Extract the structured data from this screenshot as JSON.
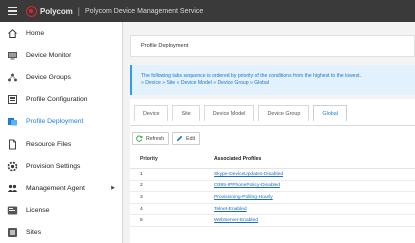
{
  "topbar": {
    "brand": "Polycom",
    "app_title": "Polycom Device Management Service"
  },
  "sidebar": {
    "items": [
      {
        "label": "Home",
        "icon": "home-icon"
      },
      {
        "label": "Device Monitor",
        "icon": "monitor-icon"
      },
      {
        "label": "Device Groups",
        "icon": "device-groups-icon"
      },
      {
        "label": "Profile Configuration",
        "icon": "profile-config-icon"
      },
      {
        "label": "Profile Deployment",
        "icon": "profile-deployment-icon",
        "active": true
      },
      {
        "label": "Resource Files",
        "icon": "file-icon"
      },
      {
        "label": "Provision Settings",
        "icon": "gear-icon"
      },
      {
        "label": "Management Agent",
        "icon": "users-icon",
        "has_submenu": true
      },
      {
        "label": "License",
        "icon": "license-icon"
      },
      {
        "label": "Sites",
        "icon": "sites-icon"
      }
    ]
  },
  "main": {
    "header": "Profile Deployment",
    "info_line1": "The following tabs sequence is ordered by priority of the conditions from the highest to the lowest.",
    "info_line2": "» Device » Site » Device Model » Device Group » Global",
    "tabs": [
      {
        "label": "Device"
      },
      {
        "label": "Site"
      },
      {
        "label": "Device Model"
      },
      {
        "label": "Device Group"
      },
      {
        "label": "Global",
        "active": true
      }
    ],
    "buttons": {
      "refresh": "Refresh",
      "edit": "Edit"
    },
    "table": {
      "columns": [
        "Priority",
        "Associated Profiles"
      ],
      "rows": [
        {
          "priority": "1",
          "profile": "Skype-DeviceUpdates-Disabled"
        },
        {
          "priority": "2",
          "profile": "O365-IPPhonePolicy-Disabled"
        },
        {
          "priority": "3",
          "profile": "Provisioning-Polling-Hourly"
        },
        {
          "priority": "4",
          "profile": "Telnet-Enabled"
        },
        {
          "priority": "5",
          "profile": "WebServer-Enabled"
        }
      ]
    }
  },
  "colors": {
    "accent": "#1a7fd4",
    "topbar": "#3a3a3a",
    "info_bg": "#e2f1fc",
    "brand_red": "#d9262f"
  }
}
